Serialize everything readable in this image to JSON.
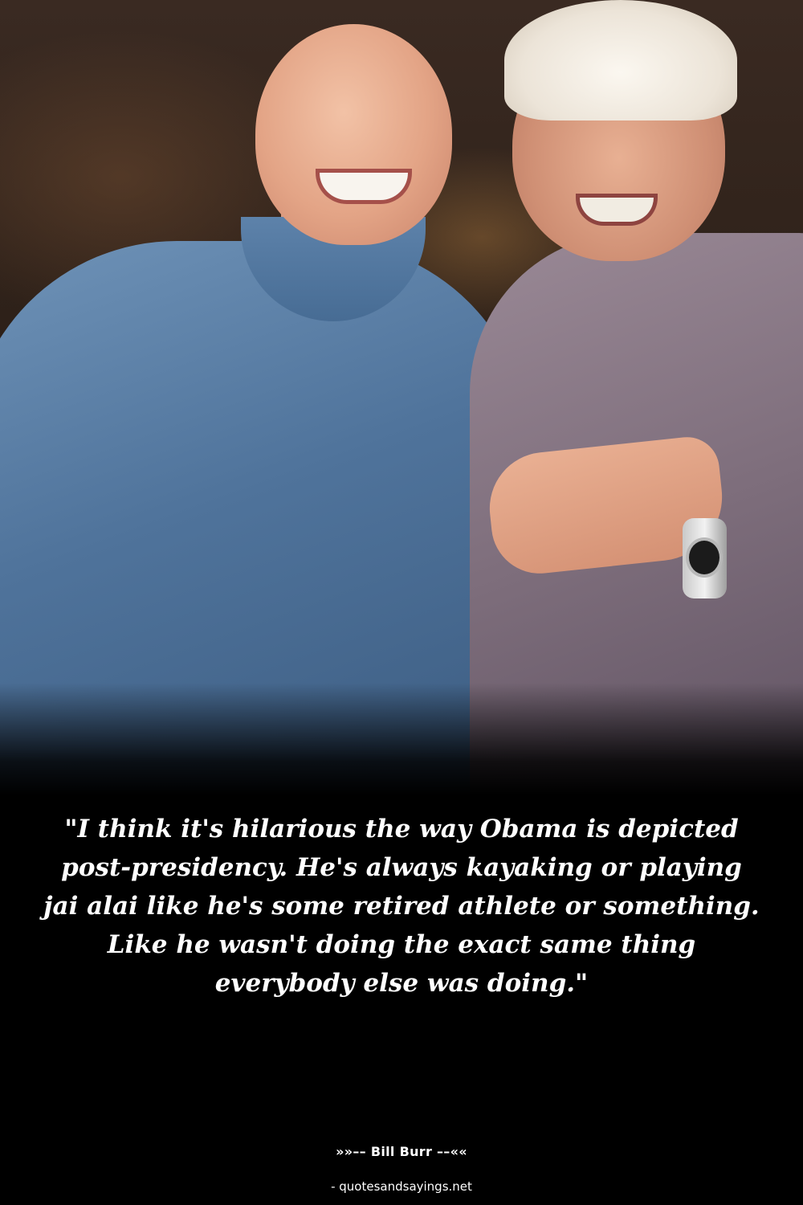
{
  "quote": {
    "text": "\"I think it's hilarious the way Obama is depicted post-presidency. He's always kayaking or playing jai alai like he's some retired athlete or something. Like he wasn't doing the exact same thing everybody else was doing.\""
  },
  "author": {
    "line": "»»–– Bill Burr ––««"
  },
  "source": {
    "line": "- quotesandsayings.net"
  },
  "colors": {
    "background": "#000000",
    "text": "#ffffff"
  }
}
